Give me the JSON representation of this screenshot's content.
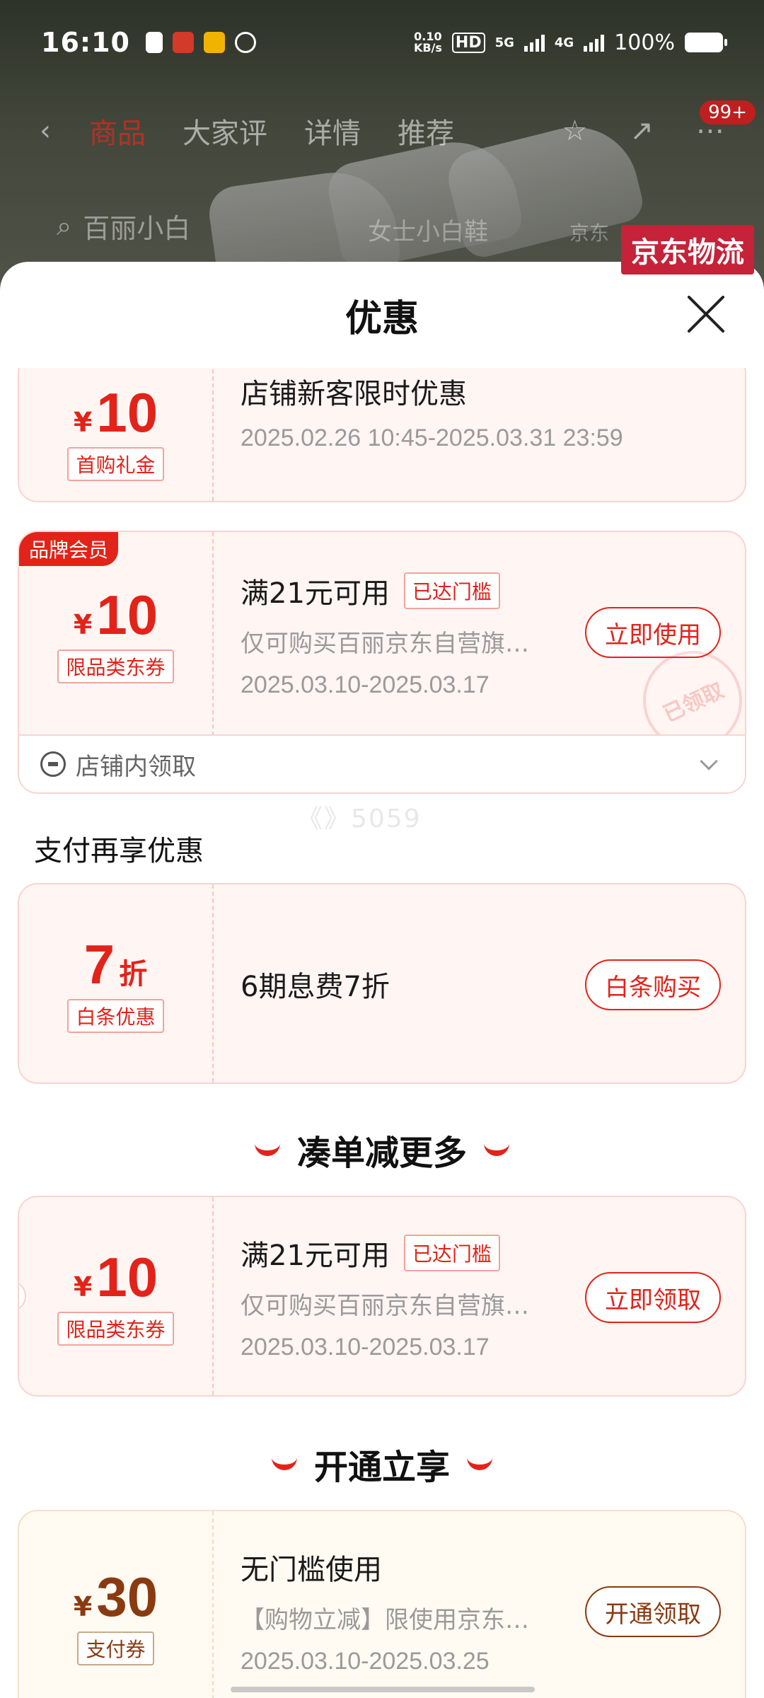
{
  "status_bar": {
    "time": "16:10",
    "net_speed": "0.10",
    "net_unit": "KB/s",
    "hd": "HD",
    "sig1": "5G",
    "sig2": "4G",
    "battery": "100%"
  },
  "background_page": {
    "tabs": [
      "商品",
      "大家评",
      "详情",
      "推荐"
    ],
    "active_tab": 0,
    "cart_badge": "99+",
    "search_text": "百丽小白",
    "search_text2": "女士小白鞋",
    "search_text3": "京东",
    "logistics_badge": "京东物流"
  },
  "sheet": {
    "title": "优惠"
  },
  "coupons": [
    {
      "yen": "¥",
      "amount": "10",
      "tag": "首购礼金",
      "title": "店铺新客限时优惠",
      "date": "2025.02.26 10:45-2025.03.31 23:59"
    },
    {
      "member_badge": "品牌会员",
      "yen": "¥",
      "amount": "10",
      "tag": "限品类东券",
      "title": "满21元可用",
      "threshold": "已达门槛",
      "desc": "仅可购买百丽京东自营旗舰店部分商品",
      "date": "2025.03.10-2025.03.17",
      "button": "立即使用",
      "stamp": "已领取",
      "footer": "店铺内领取"
    }
  ],
  "watermark": "《》5059",
  "pay_section": {
    "title": "支付再享优惠",
    "coupon": {
      "amount": "7",
      "unit": "折",
      "tag": "白条优惠",
      "title": "6期息费7折",
      "button": "白条购买"
    }
  },
  "bundle_section": {
    "title": "凑单减更多",
    "coupon": {
      "yen": "¥",
      "amount": "10",
      "tag": "限品类东券",
      "title": "满21元可用",
      "threshold": "已达门槛",
      "desc": "仅可购买百丽京东自营旗舰店部分商品",
      "date": "2025.03.10-2025.03.17",
      "button": "立即领取"
    }
  },
  "open_section": {
    "title": "开通立享",
    "coupon": {
      "yen": "¥",
      "amount": "30",
      "tag": "支付券",
      "title": "无门槛使用",
      "desc": "【购物立减】限使用京东支付时使用",
      "date": "2025.03.10-2025.03.25",
      "button": "开通领取"
    }
  },
  "colors": {
    "accent": "#e2231a",
    "gold_accent": "#8a3a10",
    "coupon_bg": "#fff5f3"
  }
}
